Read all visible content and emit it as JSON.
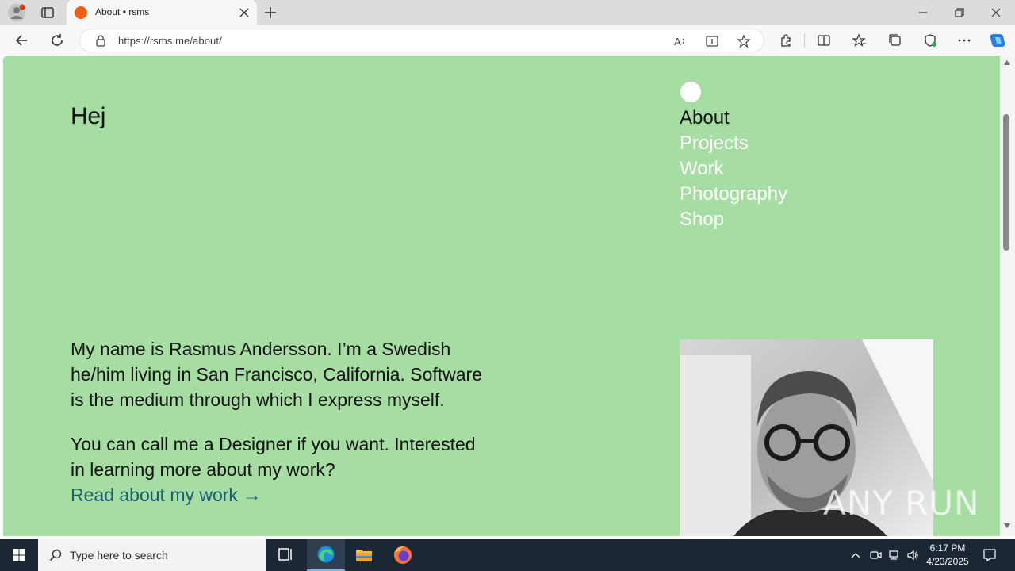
{
  "browser": {
    "tab_title": "About • rsms",
    "url": "https://rsms.me/about/"
  },
  "page": {
    "heading": "Hej",
    "nav": [
      {
        "label": "About",
        "active": true
      },
      {
        "label": "Projects",
        "active": false
      },
      {
        "label": "Work",
        "active": false
      },
      {
        "label": "Photography",
        "active": false
      },
      {
        "label": "Shop",
        "active": false
      }
    ],
    "bio_paragraph_1": "My name is Rasmus Andersson. I’m a Swedish he/him living in San Francisco, California. Software is the medium through which I express myself.",
    "bio_paragraph_2": "You can call me a Designer if you want. Interested in learning more about my work?",
    "work_link": "Read about my work →",
    "background_color": "#a5dda2",
    "watermark": "ANY RUN"
  },
  "taskbar": {
    "search_placeholder": "Type here to search",
    "time": "6:17 PM",
    "date": "4/23/2025"
  }
}
